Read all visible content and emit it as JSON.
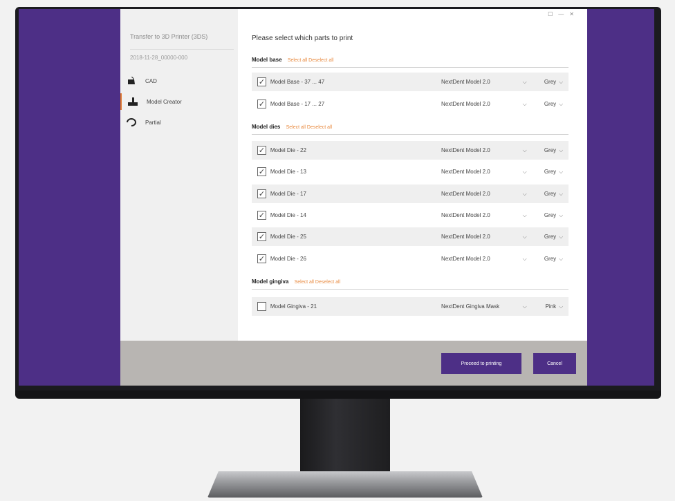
{
  "sidebar": {
    "title": "Transfer to 3D Printer (3DS)",
    "subtitle": "2018-11-28_00000-000",
    "items": [
      {
        "label": "CAD",
        "icon": "cad-icon"
      },
      {
        "label": "Model Creator",
        "icon": "model-creator-icon"
      },
      {
        "label": "Partial",
        "icon": "partial-icon"
      }
    ]
  },
  "window": {
    "controls": [
      "☐",
      "—",
      "✕"
    ]
  },
  "main": {
    "heading": "Please select which parts to print",
    "sections": [
      {
        "title": "Model base",
        "meta": "Select all   Deselect all",
        "rows": [
          {
            "label": "Model Base - 37 ... 47",
            "checked": "✓",
            "model": "NextDent Model 2.0",
            "color": "Grey"
          },
          {
            "label": "Model Base - 17 ... 27",
            "checked": "✓",
            "model": "NextDent Model 2.0",
            "color": "Grey"
          }
        ]
      },
      {
        "title": "Model dies",
        "meta": "Select all   Deselect all",
        "rows": [
          {
            "label": "Model Die - 22",
            "checked": "✓",
            "model": "NextDent Model 2.0",
            "color": "Grey"
          },
          {
            "label": "Model Die - 13",
            "checked": "✓",
            "model": "NextDent Model 2.0",
            "color": "Grey"
          },
          {
            "label": "Model Die - 17",
            "checked": "✓",
            "model": "NextDent Model 2.0",
            "color": "Grey"
          },
          {
            "label": "Model Die - 14",
            "checked": "✓",
            "model": "NextDent Model 2.0",
            "color": "Grey"
          },
          {
            "label": "Model Die - 25",
            "checked": "✓",
            "model": "NextDent Model 2.0",
            "color": "Grey"
          },
          {
            "label": "Model Die - 26",
            "checked": "✓",
            "model": "NextDent Model 2.0",
            "color": "Grey"
          }
        ]
      },
      {
        "title": "Model gingiva",
        "meta": "Select all   Deselect all",
        "rows": [
          {
            "label": "Model Gingiva - 21",
            "checked": "",
            "model": "NextDent Gingiva Mask",
            "color": "Pink"
          }
        ]
      }
    ]
  },
  "footer": {
    "proceed_label": "Proceed to printing",
    "cancel_label": "Cancel"
  },
  "colors": {
    "accent": "#4d2f86",
    "highlight": "#e8893e"
  }
}
